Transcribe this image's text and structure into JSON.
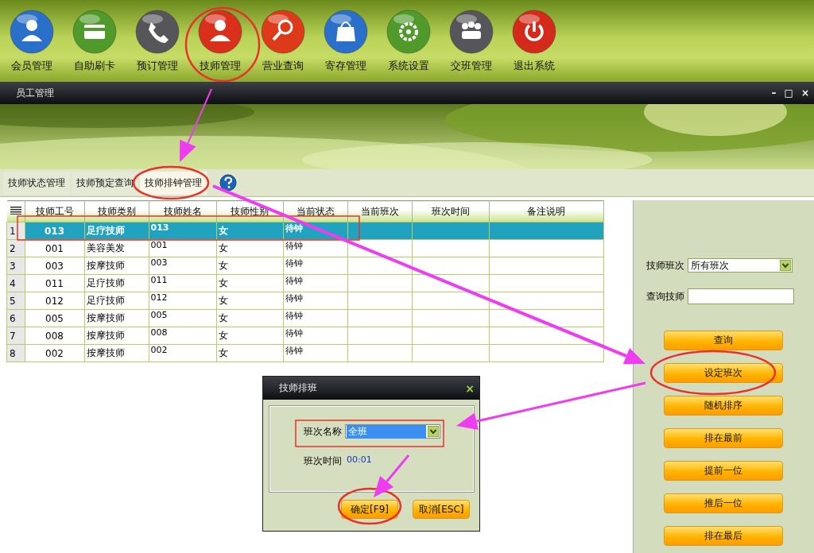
{
  "toolbar": [
    {
      "label": "会员管理",
      "color": "#2a6fc9"
    },
    {
      "label": "自助刷卡",
      "color": "#4f9a2a"
    },
    {
      "label": "预订管理",
      "color": "#55555a"
    },
    {
      "label": "技师管理",
      "color": "#d9301c"
    },
    {
      "label": "营业查询",
      "color": "#dd3a1a"
    },
    {
      "label": "寄存管理",
      "color": "#2a6fc9"
    },
    {
      "label": "系统设置",
      "color": "#4f9a2a"
    },
    {
      "label": "交班管理",
      "color": "#55555a"
    },
    {
      "label": "退出系统",
      "color": "#d42a1c"
    }
  ],
  "window": {
    "title": "员工管理",
    "controls": [
      "–",
      "□",
      "×"
    ]
  },
  "tabs": [
    {
      "label": "技师状态管理",
      "selected": false
    },
    {
      "label": "技师预定查询",
      "selected": false
    },
    {
      "label": "技师排钟管理",
      "selected": true
    }
  ],
  "table": {
    "columns": [
      "技师工号",
      "技师类别",
      "技师姓名",
      "技师性别",
      "当前状态",
      "当前班次",
      "班次时间",
      "备注说明"
    ],
    "rows": [
      {
        "index": "1",
        "cells": [
          "013",
          "足疗技师",
          "013",
          "女",
          "待钟"
        ],
        "selected": true
      },
      {
        "index": "2",
        "cells": [
          "001",
          "美容美发",
          "001",
          "女",
          "待钟"
        ],
        "selected": false
      },
      {
        "index": "3",
        "cells": [
          "003",
          "按摩技师",
          "003",
          "女",
          "待钟"
        ],
        "selected": false
      },
      {
        "index": "4",
        "cells": [
          "011",
          "足疗技师",
          "011",
          "女",
          "待钟"
        ],
        "selected": false
      },
      {
        "index": "5",
        "cells": [
          "012",
          "足疗技师",
          "012",
          "女",
          "待钟"
        ],
        "selected": false
      },
      {
        "index": "6",
        "cells": [
          "005",
          "按摩技师",
          "005",
          "女",
          "待钟"
        ],
        "selected": false
      },
      {
        "index": "7",
        "cells": [
          "008",
          "按摩技师",
          "008",
          "女",
          "待钟"
        ],
        "selected": false
      },
      {
        "index": "8",
        "cells": [
          "002",
          "按摩技师",
          "002",
          "女",
          "待钟"
        ],
        "selected": false
      }
    ]
  },
  "side_panel": {
    "shift_label": "技师班次",
    "shift_value": "所有班次",
    "search_label": "查询技师",
    "buttons": [
      "查询",
      "设定班次",
      "随机排序",
      "排在最前",
      "提前一位",
      "推后一位",
      "排在最后"
    ]
  },
  "dialog": {
    "title": "技师排班",
    "close": "×",
    "name_label": "班次名称",
    "name_value": "全班",
    "time_label": "班次时间",
    "time_value": "00:01",
    "buttons": [
      "确定[F9]",
      "取消[ESC]"
    ]
  }
}
